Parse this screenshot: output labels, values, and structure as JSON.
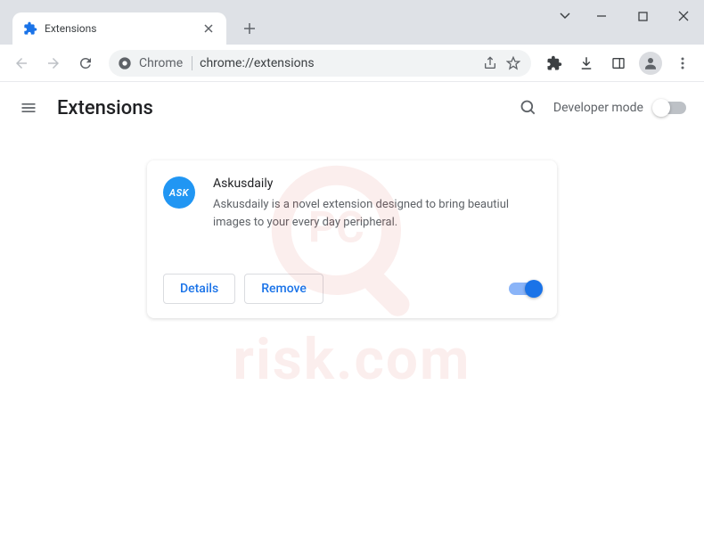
{
  "window": {
    "tab": {
      "title": "Extensions"
    }
  },
  "addressbar": {
    "chrome_label": "Chrome",
    "url": "chrome://extensions"
  },
  "header": {
    "title": "Extensions",
    "dev_mode_label": "Developer mode",
    "dev_mode_on": false
  },
  "extension": {
    "icon_text": "ASK",
    "name": "Askusdaily",
    "description": "Askusdaily is a novel extension designed to bring beautiul images to your every day peripheral.",
    "details_label": "Details",
    "remove_label": "Remove",
    "enabled": true
  },
  "watermark": {
    "text": "risk.com"
  }
}
